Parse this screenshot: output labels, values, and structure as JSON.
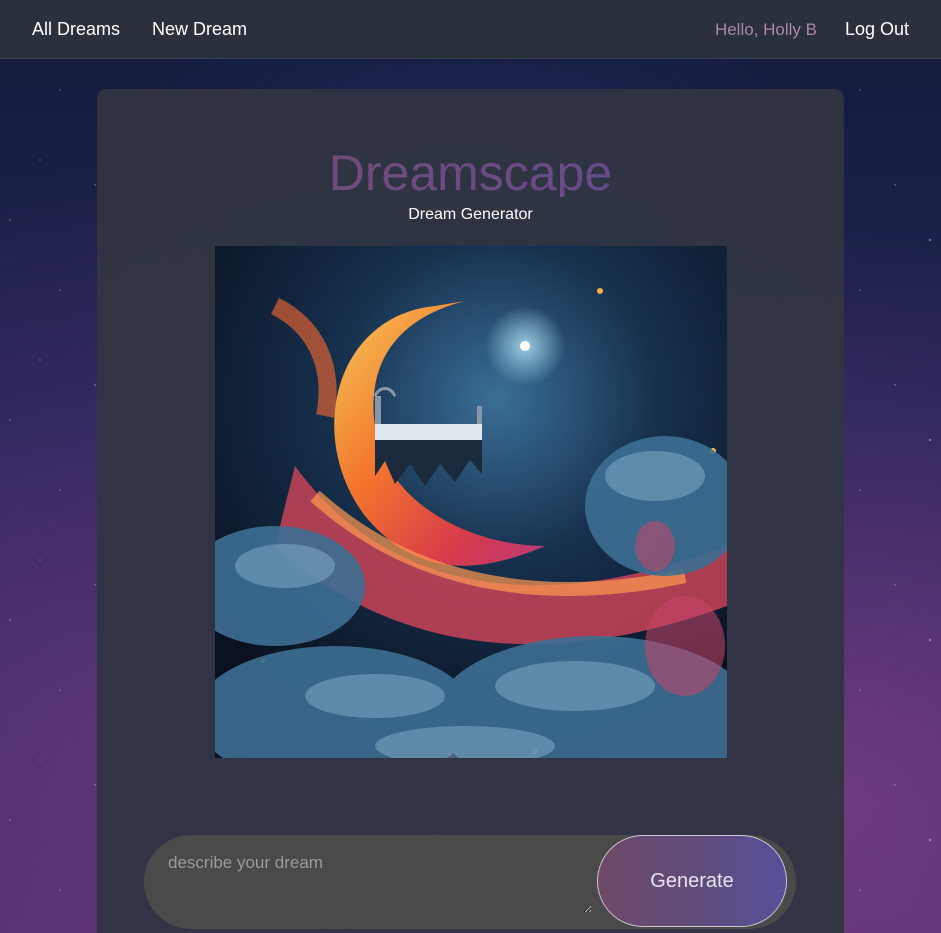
{
  "nav": {
    "all_dreams": "All Dreams",
    "new_dream": "New Dream",
    "greeting": "Hello, Holly B",
    "logout": "Log Out"
  },
  "main": {
    "brand": "Dreamscape",
    "subtitle": "Dream Generator",
    "image_icon": "dream-illustration-moon-bed-clouds"
  },
  "prompt": {
    "placeholder": "describe your dream",
    "value": "",
    "generate_label": "Generate"
  },
  "colors": {
    "navbar_bg": "#2b303d",
    "panel_bg": "#303542",
    "greeting": "#a987a8",
    "brand_gradient_start": "#7a4d6b",
    "brand_gradient_end": "#5c4a9a",
    "input_bg": "#4a4a4a"
  }
}
